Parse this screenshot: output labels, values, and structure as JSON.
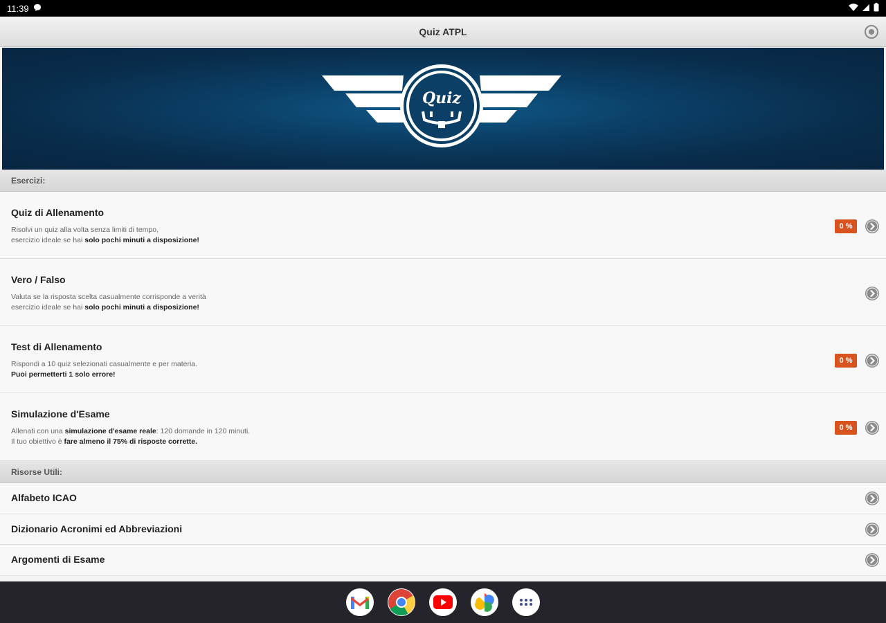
{
  "status_bar": {
    "time": "11:39"
  },
  "app_bar": {
    "title": "Quiz ATPL"
  },
  "banner": {
    "logo_text": "Quiz"
  },
  "sections": {
    "exercises": "Esercizi:",
    "resources": "Risorse Utili:"
  },
  "exercises": [
    {
      "title": "Quiz di Allenamento",
      "desc1": "Risolvi un quiz alla volta senza limiti di tempo,",
      "desc2_plain": "esercizio ideale se hai ",
      "desc2_bold": "solo pochi minuti a disposizione!",
      "badge": "0 %"
    },
    {
      "title": "Vero / Falso",
      "desc1": "Valuta se la risposta scelta casualmente corrisponde a verità",
      "desc2_plain": "esercizio ideale se hai ",
      "desc2_bold": "solo pochi minuti a disposizione!"
    },
    {
      "title": "Test di Allenamento",
      "desc1": "Rispondi a 10 quiz selezionati casualmente e per materia.",
      "desc2_bold": "Puoi permetterti 1 solo errore!",
      "badge": "0 %"
    },
    {
      "title": "Simulazione d'Esame",
      "desc1_plain_a": "Allenati con una ",
      "desc1_bold": "simulazione d'esame reale",
      "desc1_plain_b": ": 120 domande in 120 minuti.",
      "desc2_plain": "Il tuo obiettivo è ",
      "desc2_bold": "fare almeno il 75% di risposte corrette.",
      "badge": "0 %"
    }
  ],
  "resources": [
    {
      "title": "Alfabeto ICAO"
    },
    {
      "title": "Dizionario Acronimi ed Abbreviazioni"
    },
    {
      "title": "Argomenti di Esame"
    }
  ],
  "dock": [
    "gmail-icon",
    "chrome-icon",
    "youtube-icon",
    "photos-icon",
    "app-drawer-icon"
  ],
  "colors": {
    "badge": "#d9531e",
    "banner": "#0b3f66",
    "dock": "#24242a"
  }
}
